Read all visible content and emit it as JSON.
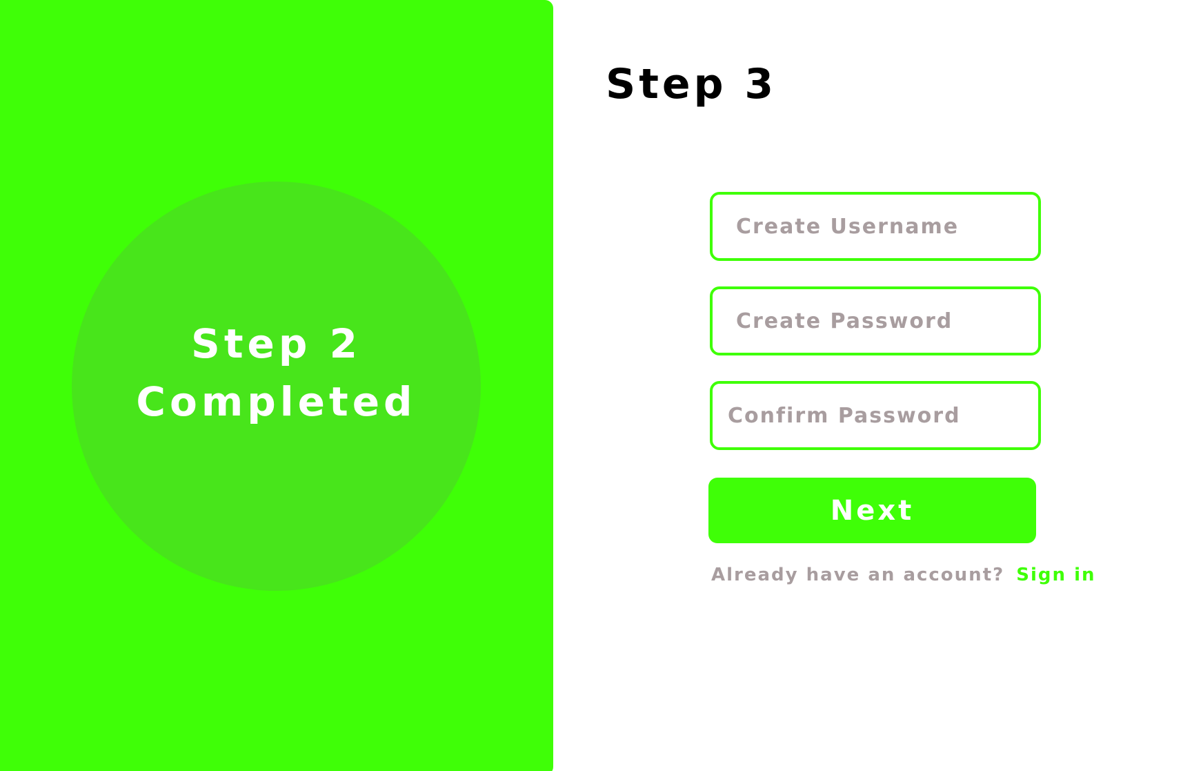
{
  "colors": {
    "accent": "#3fff07",
    "circle": "#48e51b",
    "placeholder_text": "#a89d9f",
    "title_text": "#000000"
  },
  "left_panel": {
    "status_line1": "Step 2",
    "status_line2": "Completed"
  },
  "form": {
    "title": "Step 3",
    "username_placeholder": "Create Username",
    "password_placeholder": "Create Password",
    "confirm_placeholder": "Confirm Password",
    "next_label": "Next",
    "signin_prompt": "Already have an account?",
    "signin_link": "Sign in"
  }
}
